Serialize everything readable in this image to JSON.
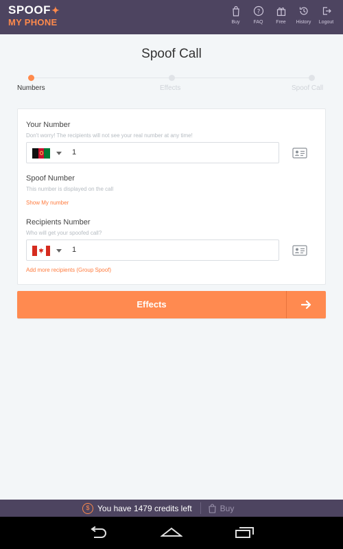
{
  "app": {
    "logo_top": "SPOOF",
    "logo_bottom": "MY PHONE",
    "nav": [
      {
        "label": "Buy",
        "icon": "shopping-bag-icon"
      },
      {
        "label": "FAQ",
        "icon": "question-circle-icon"
      },
      {
        "label": "Free",
        "icon": "gift-icon"
      },
      {
        "label": "History",
        "icon": "history-icon"
      },
      {
        "label": "Logout",
        "icon": "logout-icon"
      }
    ]
  },
  "page": {
    "title": "Spoof Call",
    "steps": [
      {
        "label": "Numbers",
        "active": true
      },
      {
        "label": "Effects",
        "active": false
      },
      {
        "label": "Spoof Call",
        "active": false
      }
    ]
  },
  "form": {
    "your_number": {
      "label": "Your Number",
      "hint": "Don't worry! The recipients will not see your real number at any time!",
      "country_flag": "afghanistan-flag",
      "value": "1"
    },
    "spoof_number": {
      "label": "Spoof Number",
      "hint": "This number is displayed on the call",
      "link": "Show My number"
    },
    "recipients": {
      "label": "Recipients Number",
      "hint": "Who will get your spoofed call?",
      "country_flag": "canada-flag",
      "value": "1",
      "add_link": "Add more recipients (Group Spoof)"
    }
  },
  "actions": {
    "effects_label": "Effects"
  },
  "credits": {
    "text": "You have 1479 credits left",
    "buy_label": "Buy"
  },
  "colors": {
    "header_bg": "#4d4460",
    "accent": "#ff8a50",
    "background": "#f3f6f8"
  }
}
